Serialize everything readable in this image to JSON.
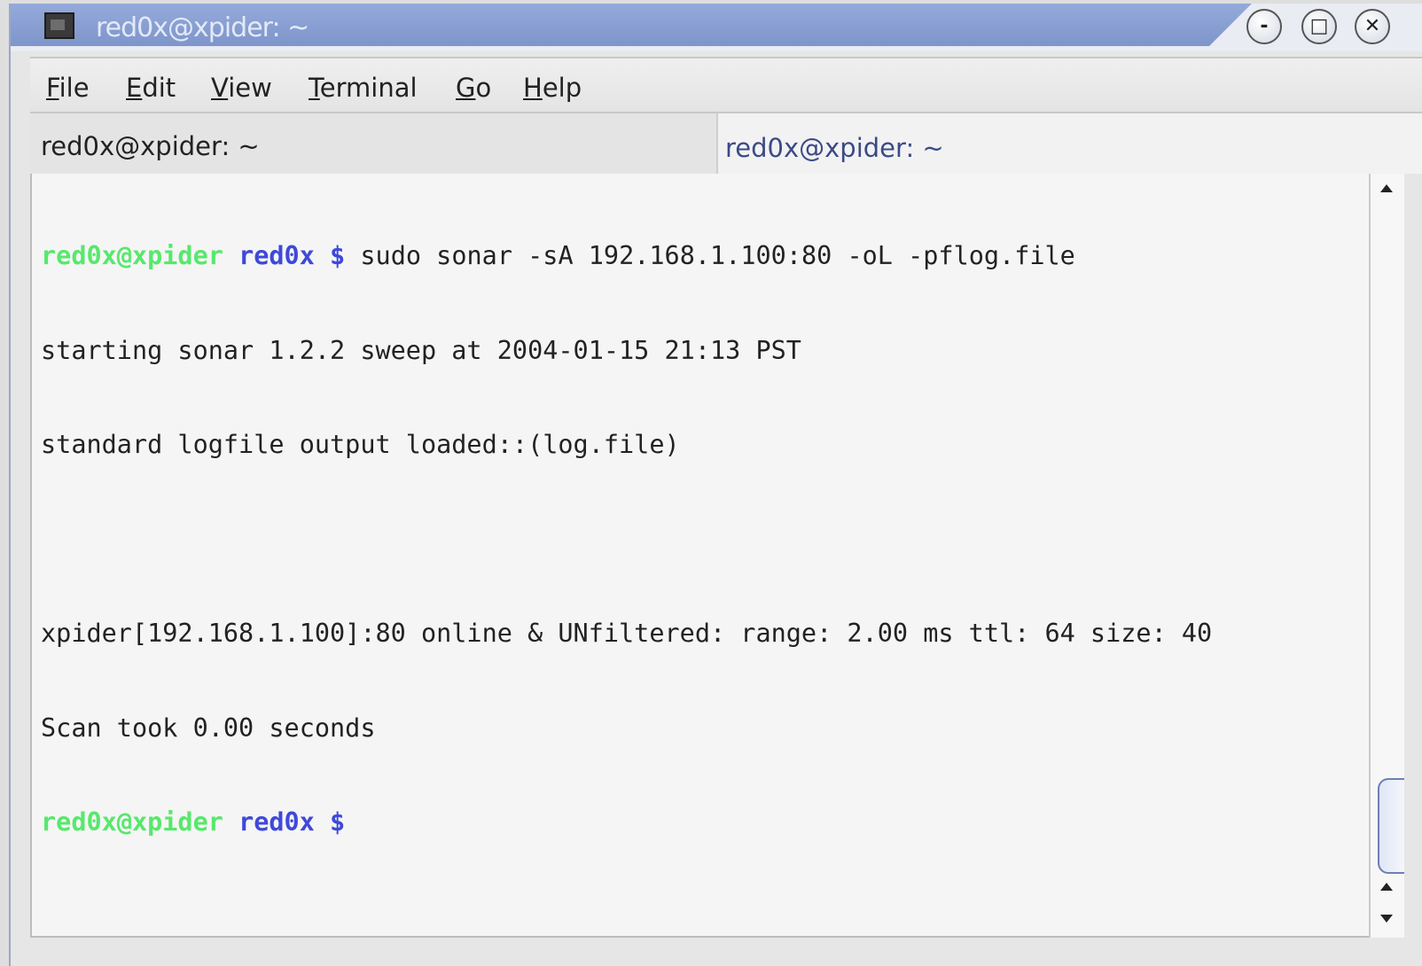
{
  "window": {
    "title": "red0x@xpider: ~",
    "buttons": {
      "minimize": "-",
      "maximize": "□",
      "close": "✕"
    }
  },
  "menu": [
    {
      "mnemonic": "F",
      "rest": "ile"
    },
    {
      "mnemonic": "E",
      "rest": "dit"
    },
    {
      "mnemonic": "V",
      "rest": "iew"
    },
    {
      "mnemonic": "T",
      "rest": "erminal"
    },
    {
      "mnemonic": "G",
      "rest": "o"
    },
    {
      "mnemonic": "H",
      "rest": "elp"
    }
  ],
  "tabs": [
    {
      "label": "red0x@xpider: ~",
      "active": true
    },
    {
      "label": "red0x@xpider: ~",
      "active": false
    }
  ],
  "terminal": {
    "prompt": {
      "host": "red0x@xpider",
      "dir": "red0x",
      "symbol": "$"
    },
    "lines": [
      {
        "cmd": "sudo sonar -sA 192.168.1.100:80 -oL -pflog.file"
      },
      {
        "text": "starting sonar 1.2.2 sweep at 2004-01-15 21:13 PST"
      },
      {
        "text": "standard logfile output loaded::(log.file)"
      },
      {
        "text": ""
      },
      {
        "text": "xpider[192.168.1.100]:80 online & UNfiltered: range: 2.00 ms ttl: 64 size: 40"
      },
      {
        "text": "Scan took 0.00 seconds"
      }
    ]
  },
  "colors": {
    "prompt_host": "#57e86c",
    "prompt_dir": "#3f49d9",
    "titlebar": "#7e95cb"
  },
  "icons": {
    "app": "terminal-icon",
    "scroll_up": "triangle-up",
    "scroll_down": "triangle-down"
  }
}
